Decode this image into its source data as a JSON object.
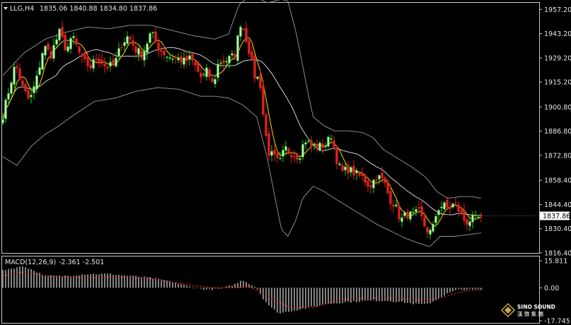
{
  "header": {
    "symbol": "LLG,H4",
    "ohlc": "1835.06 1840.88 1834.80 1837.86"
  },
  "macd_header": {
    "label": "MACD(12,26,9)",
    "values": "-2.361 -2.501"
  },
  "colors": {
    "bull": "#22cc22",
    "bull_body": "#b8f0b0",
    "bear": "#e02020",
    "ma_fast": "#ffd700",
    "ma_slow": "#e8e8e8",
    "bands": "#9a9a9a",
    "macd_hist": "#dddddd",
    "macd_signal": "#e02020",
    "frame": "#c8c8c8"
  },
  "watermark": {
    "line1": "SINO SOUND",
    "line2": "漢 聲 集 團"
  },
  "chart_data": [
    {
      "type": "candlestick",
      "title": "LLG,H4",
      "ylim": [
        1816.4,
        1961.0
      ],
      "yticks": [
        1957.2,
        1943.2,
        1929.2,
        1915.2,
        1900.8,
        1886.8,
        1872.8,
        1858.4,
        1844.4,
        1830.4,
        1816.4
      ],
      "current_price": 1837.86,
      "anchors": [
        [
          0,
          1896
        ],
        [
          10,
          1913
        ],
        [
          18,
          1926
        ],
        [
          28,
          1912
        ],
        [
          38,
          1904
        ],
        [
          48,
          1917
        ],
        [
          58,
          1936
        ],
        [
          68,
          1931
        ],
        [
          80,
          1944
        ],
        [
          90,
          1934
        ],
        [
          100,
          1941
        ],
        [
          112,
          1928
        ],
        [
          124,
          1924
        ],
        [
          134,
          1930
        ],
        [
          146,
          1924
        ],
        [
          158,
          1925
        ],
        [
          168,
          1937
        ],
        [
          178,
          1942
        ],
        [
          188,
          1934
        ],
        [
          198,
          1931
        ],
        [
          210,
          1944
        ],
        [
          222,
          1934
        ],
        [
          234,
          1930
        ],
        [
          246,
          1929
        ],
        [
          258,
          1927
        ],
        [
          266,
          1929
        ],
        [
          272,
          1925
        ],
        [
          282,
          1917
        ],
        [
          290,
          1922
        ],
        [
          298,
          1913
        ],
        [
          306,
          1927
        ],
        [
          314,
          1927
        ],
        [
          322,
          1929
        ],
        [
          330,
          1931
        ],
        [
          336,
          1950
        ],
        [
          342,
          1945
        ],
        [
          350,
          1932
        ],
        [
          358,
          1917
        ],
        [
          364,
          1918
        ],
        [
          370,
          1893
        ],
        [
          376,
          1875
        ],
        [
          384,
          1872
        ],
        [
          392,
          1868
        ],
        [
          400,
          1877
        ],
        [
          410,
          1874
        ],
        [
          420,
          1872
        ],
        [
          428,
          1882
        ],
        [
          438,
          1878
        ],
        [
          448,
          1878
        ],
        [
          458,
          1879
        ],
        [
          466,
          1885
        ],
        [
          472,
          1872
        ],
        [
          480,
          1863
        ],
        [
          490,
          1865
        ],
        [
          500,
          1862
        ],
        [
          510,
          1860
        ],
        [
          520,
          1855
        ],
        [
          530,
          1861
        ],
        [
          540,
          1858
        ],
        [
          548,
          1848
        ],
        [
          556,
          1844
        ],
        [
          564,
          1835
        ],
        [
          572,
          1839
        ],
        [
          580,
          1838
        ],
        [
          590,
          1840
        ],
        [
          600,
          1830
        ],
        [
          608,
          1828
        ],
        [
          616,
          1842
        ],
        [
          624,
          1844
        ],
        [
          632,
          1842
        ],
        [
          640,
          1845
        ],
        [
          648,
          1840
        ],
        [
          656,
          1834
        ],
        [
          664,
          1836
        ],
        [
          672,
          1836
        ],
        [
          678,
          1837.86
        ]
      ],
      "bands_upper": [
        [
          0,
          1919
        ],
        [
          30,
          1932
        ],
        [
          60,
          1940
        ],
        [
          90,
          1944
        ],
        [
          120,
          1947
        ],
        [
          150,
          1946
        ],
        [
          180,
          1948
        ],
        [
          210,
          1948
        ],
        [
          240,
          1945
        ],
        [
          270,
          1942
        ],
        [
          300,
          1940
        ],
        [
          320,
          1943
        ],
        [
          335,
          1960
        ],
        [
          350,
          1965
        ],
        [
          365,
          1963
        ],
        [
          375,
          1961
        ],
        [
          385,
          1962
        ],
        [
          395,
          1963
        ],
        [
          404,
          1962
        ],
        [
          415,
          1945
        ],
        [
          425,
          1925
        ],
        [
          432,
          1910
        ],
        [
          440,
          1895
        ],
        [
          455,
          1890
        ],
        [
          470,
          1887
        ],
        [
          490,
          1887
        ],
        [
          510,
          1886
        ],
        [
          525,
          1883
        ],
        [
          540,
          1876
        ],
        [
          560,
          1871
        ],
        [
          580,
          1866
        ],
        [
          600,
          1860
        ],
        [
          615,
          1852
        ],
        [
          630,
          1848
        ],
        [
          650,
          1849
        ],
        [
          665,
          1849
        ],
        [
          678,
          1848
        ]
      ],
      "bands_lower": [
        [
          0,
          1872
        ],
        [
          20,
          1867
        ],
        [
          40,
          1878
        ],
        [
          60,
          1885
        ],
        [
          80,
          1890
        ],
        [
          100,
          1896
        ],
        [
          130,
          1904
        ],
        [
          160,
          1906
        ],
        [
          190,
          1910
        ],
        [
          220,
          1912
        ],
        [
          250,
          1911
        ],
        [
          280,
          1907
        ],
        [
          300,
          1907
        ],
        [
          320,
          1906
        ],
        [
          340,
          1902
        ],
        [
          360,
          1895
        ],
        [
          375,
          1871
        ],
        [
          385,
          1850
        ],
        [
          395,
          1830
        ],
        [
          404,
          1826
        ],
        [
          415,
          1835
        ],
        [
          425,
          1848
        ],
        [
          440,
          1855
        ],
        [
          455,
          1852
        ],
        [
          470,
          1848
        ],
        [
          490,
          1843
        ],
        [
          510,
          1838
        ],
        [
          530,
          1833
        ],
        [
          550,
          1829
        ],
        [
          570,
          1825
        ],
        [
          590,
          1822
        ],
        [
          605,
          1820
        ],
        [
          620,
          1826
        ],
        [
          640,
          1826
        ],
        [
          660,
          1827
        ],
        [
          678,
          1828
        ]
      ]
    },
    {
      "type": "bar",
      "title": "MACD(12,26,9)",
      "ylim": [
        -17.745,
        15.811
      ],
      "yticks": [
        15.811,
        0.0,
        -17.745
      ],
      "histogram_anchors": [
        [
          0,
          9
        ],
        [
          30,
          11
        ],
        [
          60,
          6
        ],
        [
          90,
          6
        ],
        [
          120,
          7
        ],
        [
          150,
          7
        ],
        [
          180,
          6
        ],
        [
          210,
          5
        ],
        [
          240,
          3
        ],
        [
          270,
          0
        ],
        [
          290,
          -1
        ],
        [
          310,
          -0.5
        ],
        [
          330,
          2
        ],
        [
          340,
          4
        ],
        [
          350,
          2
        ],
        [
          360,
          0
        ],
        [
          370,
          -6
        ],
        [
          380,
          -10
        ],
        [
          392,
          -13
        ],
        [
          404,
          -12
        ],
        [
          420,
          -11
        ],
        [
          440,
          -9.5
        ],
        [
          460,
          -8
        ],
        [
          480,
          -7.5
        ],
        [
          500,
          -7
        ],
        [
          520,
          -6.5
        ],
        [
          540,
          -6.5
        ],
        [
          560,
          -7
        ],
        [
          580,
          -8
        ],
        [
          600,
          -8.5
        ],
        [
          615,
          -6
        ],
        [
          630,
          -3
        ],
        [
          645,
          -1
        ],
        [
          660,
          -1
        ],
        [
          678,
          -1
        ]
      ],
      "signal_anchors": [
        [
          0,
          6
        ],
        [
          30,
          8
        ],
        [
          60,
          6
        ],
        [
          90,
          5.5
        ],
        [
          120,
          5
        ],
        [
          150,
          5.5
        ],
        [
          180,
          5
        ],
        [
          210,
          4.5
        ],
        [
          240,
          3
        ],
        [
          270,
          1
        ],
        [
          300,
          0
        ],
        [
          330,
          0
        ],
        [
          350,
          0.5
        ],
        [
          370,
          -3
        ],
        [
          385,
          -6
        ],
        [
          400,
          -9
        ],
        [
          415,
          -10
        ],
        [
          440,
          -10
        ],
        [
          460,
          -8
        ],
        [
          480,
          -6
        ],
        [
          500,
          -5.5
        ],
        [
          520,
          -5
        ],
        [
          540,
          -5
        ],
        [
          560,
          -5.5
        ],
        [
          580,
          -6
        ],
        [
          600,
          -6.5
        ],
        [
          620,
          -5
        ],
        [
          640,
          -3
        ],
        [
          660,
          -1.5
        ],
        [
          678,
          -1
        ]
      ]
    }
  ]
}
